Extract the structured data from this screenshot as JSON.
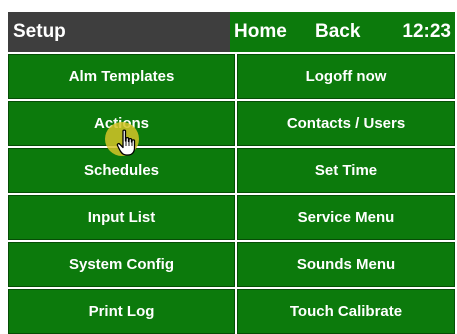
{
  "header": {
    "title": "Setup",
    "home_label": "Home",
    "back_label": "Back",
    "clock": "12:23"
  },
  "buttons": {
    "left": [
      "Alm Templates",
      "Actions",
      "Schedules",
      "Input List",
      "System Config",
      "Print Log"
    ],
    "right": [
      "Logoff now",
      "Contacts / Users",
      "Set Time",
      "Service Menu",
      "Sounds Menu",
      "Touch Calibrate"
    ]
  },
  "colors": {
    "header_bg": "#3e3e3e",
    "button_green": "#0c7a0c",
    "button_border": "#064d06",
    "touch_highlight": "#d6c428",
    "text": "#ffffff"
  },
  "icons": {
    "cursor": "hand-pointer-icon"
  }
}
